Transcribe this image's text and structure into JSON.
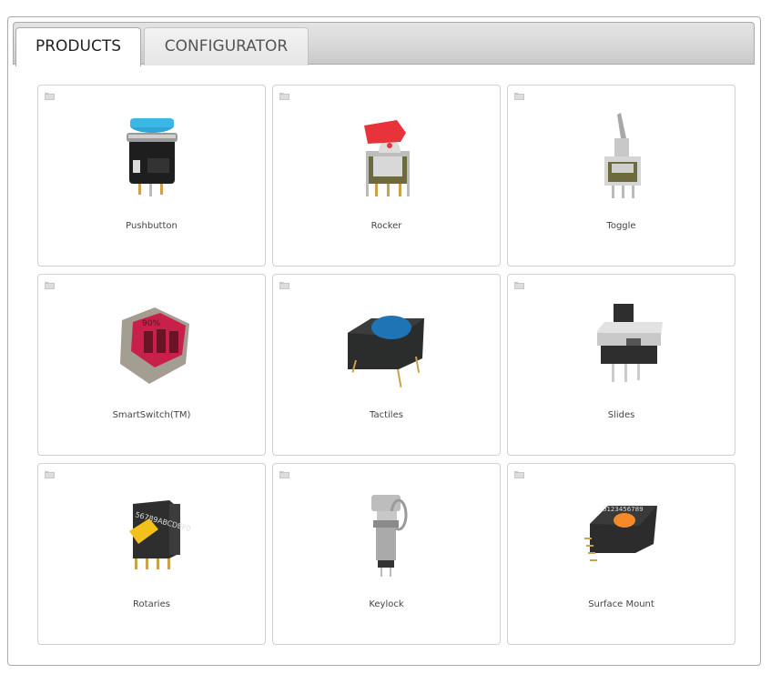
{
  "tabs": [
    {
      "label": "PRODUCTS",
      "active": true
    },
    {
      "label": "CONFIGURATOR",
      "active": false
    }
  ],
  "products": [
    {
      "name": "Pushbutton",
      "icon": "pushbutton-switch-image"
    },
    {
      "name": "Rocker",
      "icon": "rocker-switch-image"
    },
    {
      "name": "Toggle",
      "icon": "toggle-switch-image"
    },
    {
      "name": "SmartSwitch(TM)",
      "icon": "smartswitch-image",
      "display_text": "90%"
    },
    {
      "name": "Tactiles",
      "icon": "tactile-switch-image"
    },
    {
      "name": "Slides",
      "icon": "slide-switch-image"
    },
    {
      "name": "Rotaries",
      "icon": "rotary-switch-image",
      "dial_text": "56789ABCDEF0"
    },
    {
      "name": "Keylock",
      "icon": "keylock-switch-image"
    },
    {
      "name": "Surface Mount",
      "icon": "surface-mount-switch-image",
      "dial_text": "0123456789"
    }
  ],
  "colors": {
    "pushbutton_cap": "#2fa6d6",
    "rocker_cap": "#e8333b",
    "smartswitch_screen": "#c8204a",
    "tactile_cap": "#1f74b6",
    "rotary_knob": "#f2c21a",
    "smd_knob": "#f48a2a"
  }
}
